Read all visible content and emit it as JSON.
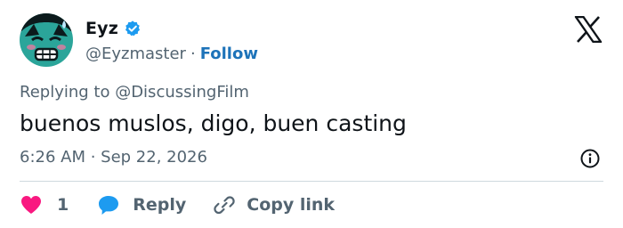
{
  "author": {
    "display_name": "Eyz",
    "handle": "@Eyzmaster",
    "separator": "·",
    "follow_label": "Follow",
    "verified_icon": "verified-badge-icon",
    "verified_color": "#1d9bf0"
  },
  "platform": {
    "logo_icon": "x-logo-icon"
  },
  "tweet": {
    "replying_to": "Replying to @DiscussingFilm",
    "text": "buenos muslos, digo, buen casting",
    "timestamp": "6:26 AM · Sep 22, 2026"
  },
  "actions": {
    "like_count": "1",
    "like_color": "#f91880",
    "reply_label": "Reply",
    "reply_color": "#1d9bf0",
    "copy_link_label": "Copy link"
  },
  "colors": {
    "link": "#1d73b9",
    "secondary_text": "#536471",
    "primary_text": "#0f1419"
  }
}
